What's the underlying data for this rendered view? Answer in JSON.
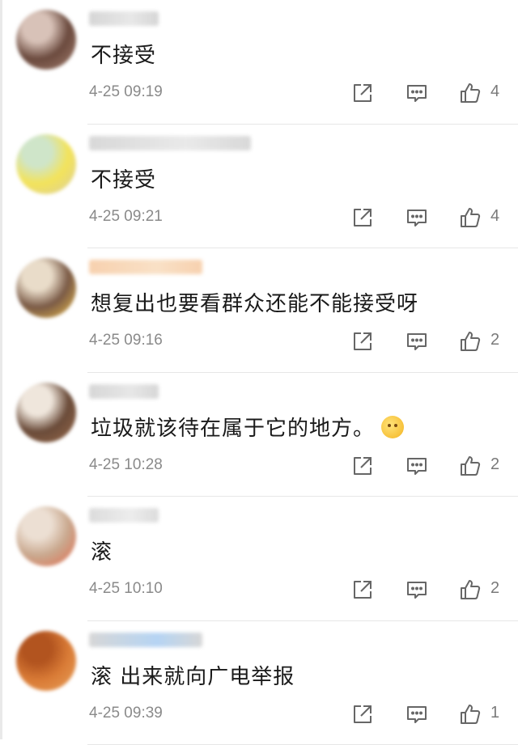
{
  "comments": [
    {
      "text": "不接受",
      "timestamp": "4-25 09:19",
      "likes": "4",
      "avatar_colors": [
        "#6b4a3e",
        "#d8c2b8",
        "#a58070"
      ],
      "username_colors": [
        "#cfcfcf",
        "#e4e4e4"
      ],
      "username_width": "short"
    },
    {
      "text": "不接受",
      "timestamp": "4-25 09:21",
      "likes": "4",
      "avatar_colors": [
        "#f3e35a",
        "#cfe5c9",
        "#d9cda6"
      ],
      "username_colors": [
        "#d2d2d2",
        "#e6e6e6"
      ],
      "username_width": "long"
    },
    {
      "text": "想复出也要看群众还能不能接受呀",
      "timestamp": "4-25 09:16",
      "likes": "2",
      "avatar_colors": [
        "#7a5a46",
        "#e9dcc9",
        "#f2c34d"
      ],
      "username_colors": [
        "#f6c9a1",
        "#f8dcbd"
      ],
      "username_width": "medium"
    },
    {
      "text": "垃圾就该待在属于它的地方。",
      "timestamp": "4-25 10:28",
      "likes": "2",
      "avatar_colors": [
        "#6a4b39",
        "#efe6dc",
        "#9a6b4c"
      ],
      "username_colors": [
        "#d0d0d0",
        "#e3e3e3"
      ],
      "username_width": "short"
    },
    {
      "text": "滚",
      "timestamp": "4-25 10:10",
      "likes": "2",
      "avatar_colors": [
        "#c9a88e",
        "#ecdfd3",
        "#e46a4c"
      ],
      "username_colors": [
        "#d6d6d6",
        "#eaeaea"
      ],
      "username_width": "short"
    },
    {
      "text": "滚 出来就向广电举报",
      "timestamp": "4-25 09:39",
      "likes": "1",
      "avatar_colors": [
        "#d97b36",
        "#b2541f",
        "#e9a15a"
      ],
      "username_colors": [
        "#d0d0d0",
        "#a9cdf2"
      ],
      "username_width": "medium"
    }
  ],
  "icons": {
    "share": "share-icon",
    "reply": "reply-icon",
    "like": "thumbs-up-icon"
  },
  "colors": {
    "text": "#1a1a1a",
    "meta": "#8a8a8a",
    "icon": "#666666"
  }
}
